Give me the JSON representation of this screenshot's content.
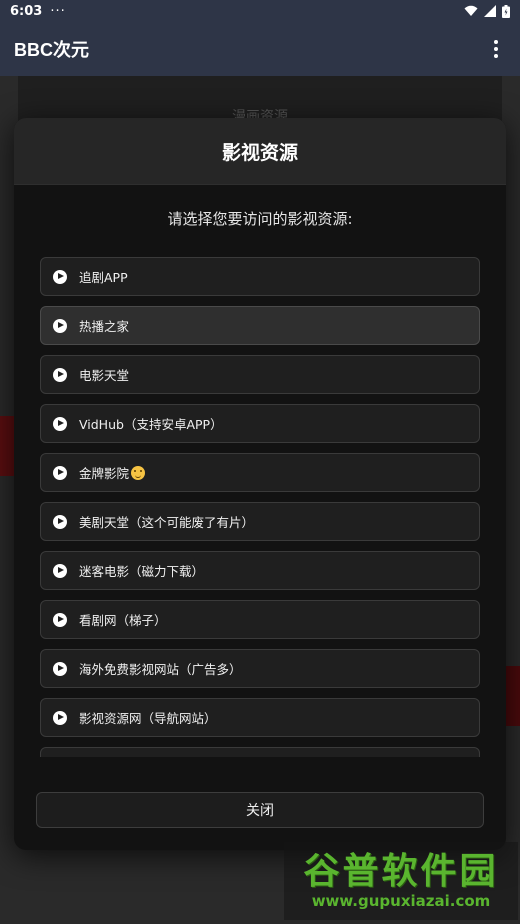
{
  "status_bar": {
    "time": "6:03",
    "dots": "···",
    "icons": [
      "wifi-icon",
      "signal-icon",
      "battery-icon"
    ]
  },
  "app_bar": {
    "title": "BBC次元",
    "menu_icon": "more-vert-icon"
  },
  "background": {
    "label": "漫画资源"
  },
  "dialog": {
    "title": "影视资源",
    "subtitle": "请选择您要访问的影视资源:",
    "items": [
      {
        "label": "追剧APP",
        "icon": "play-icon"
      },
      {
        "label": "热播之家",
        "icon": "play-icon",
        "selected": true
      },
      {
        "label": "电影天堂",
        "icon": "play-icon"
      },
      {
        "label": "VidHub（支持安卓APP）",
        "icon": "play-icon"
      },
      {
        "label": "金牌影院",
        "icon": "play-icon",
        "emoji": "smile-emoji"
      },
      {
        "label": "美剧天堂（这个可能废了有片）",
        "icon": "play-icon"
      },
      {
        "label": "迷客电影（磁力下载）",
        "icon": "play-icon"
      },
      {
        "label": "看剧网（梯子）",
        "icon": "play-icon"
      },
      {
        "label": "海外免费影视网站（广告多）",
        "icon": "play-icon"
      },
      {
        "label": "影视资源网（导航网站）",
        "icon": "play-icon"
      }
    ],
    "close_label": "关闭"
  },
  "watermark": {
    "logo": "谷普软件园",
    "url": "www.gupuxiazai.com"
  },
  "colors": {
    "app_bar": "#2e3547",
    "dialog_bg": "#121212",
    "item_bg": "#1f1f1f",
    "watermark_green": "#5ab52f"
  }
}
